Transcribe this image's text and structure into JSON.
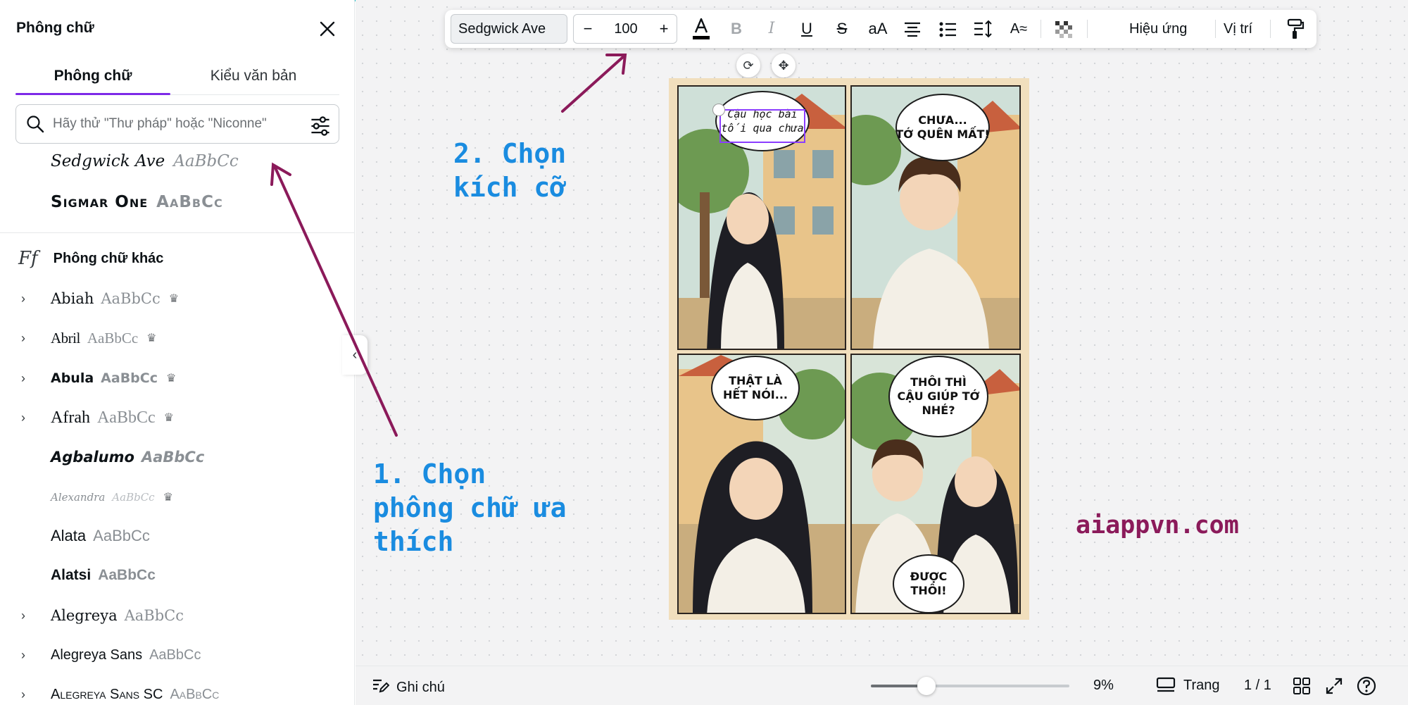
{
  "panel": {
    "title": "Phông chữ",
    "tabs": [
      {
        "label": "Phông chữ",
        "active": true
      },
      {
        "label": "Kiểu văn bản",
        "active": false
      }
    ],
    "search_placeholder": "Hãy thử \"Thư pháp\" hoặc \"Niconne\"",
    "recent_fonts": [
      {
        "name": "Sedgwick Ave",
        "sample": "AaBbCc"
      },
      {
        "name": "Sigmar One",
        "sample": "AaBbCc"
      }
    ],
    "more_header": "Phông chữ khác",
    "more_icon_text": "Ff",
    "fonts": [
      {
        "name": "Abiah",
        "sample": "AaBbCc",
        "expandable": true,
        "premium": true
      },
      {
        "name": "Abril",
        "sample": "AaBbCc",
        "expandable": true,
        "premium": true
      },
      {
        "name": "Abula",
        "sample": "AaBbCc",
        "expandable": true,
        "premium": true
      },
      {
        "name": "Afrah",
        "sample": "AaBbCc",
        "expandable": true,
        "premium": true
      },
      {
        "name": "Agbalumo",
        "sample": "AaBbCc",
        "expandable": false,
        "premium": false
      },
      {
        "name": "Alexandra",
        "sample": "AaBbCc",
        "expandable": false,
        "premium": true
      },
      {
        "name": "Alata",
        "sample": "AaBbCc",
        "expandable": false,
        "premium": false
      },
      {
        "name": "Alatsi",
        "sample": "AaBbCc",
        "expandable": false,
        "premium": false
      },
      {
        "name": "Alegreya",
        "sample": "AaBbCc",
        "expandable": true,
        "premium": false
      },
      {
        "name": "Alegreya Sans",
        "sample": "AaBbCc",
        "expandable": true,
        "premium": false
      },
      {
        "name": "Alegreya Sans SC",
        "sample": "AaBbCc",
        "expandable": true,
        "premium": false
      }
    ]
  },
  "toolbar": {
    "font_name": "Sedgwick Ave",
    "font_size": "100",
    "minus": "−",
    "plus": "+",
    "effects": "Hiệu ứng",
    "position": "Vị trí",
    "text_color": "#000000"
  },
  "annotations": {
    "step1": "1. Chọn\nphông chữ ưa\nthích",
    "step2": "2. Chọn\nkích cỡ",
    "watermark": "aiappvn.com",
    "arrow_color": "#8b1a5a",
    "text_color": "#1a8ce0"
  },
  "comic": {
    "bubbles": [
      "Cậu học bài\ntối qua chưa",
      "CHƯA...\nTỚ QUÊN MẤT!",
      "THẬT LÀ\nHẾT NÓI...",
      "THÔI THÌ\nCẬU GIÚP TỚ\nNHÉ?",
      "ĐƯỢC\nTHÔI!"
    ]
  },
  "footer": {
    "notes": "Ghi chú",
    "zoom": "9%",
    "zoom_fraction": 0.28,
    "pages_label": "Trang",
    "page_count": "1 / 1"
  },
  "colors": {
    "accent": "#7d2ae8",
    "selection": "#8b3dff"
  }
}
